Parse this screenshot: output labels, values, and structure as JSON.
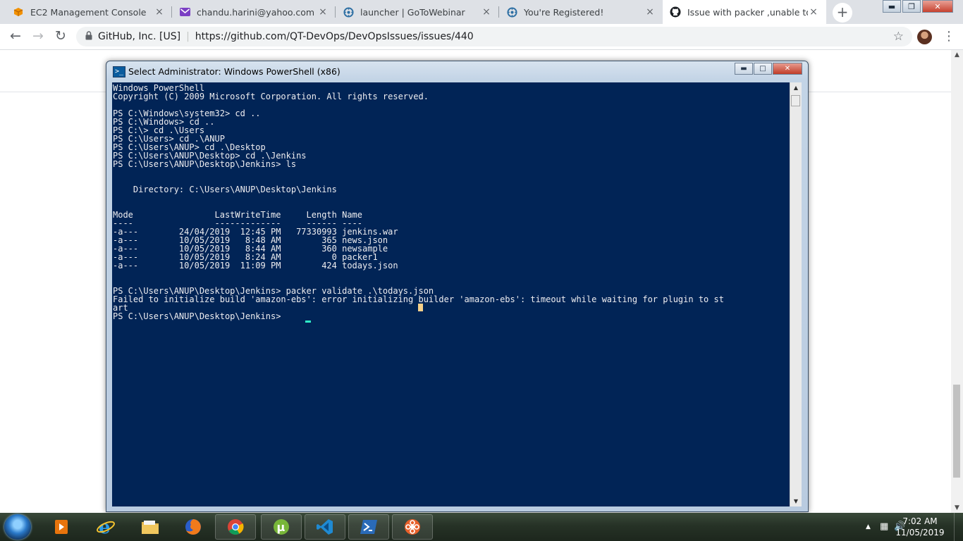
{
  "browser": {
    "tabs": [
      {
        "title": "EC2 Management Console",
        "icon": "aws-cube-icon",
        "active": false
      },
      {
        "title": "chandu.harini@yahoo.com - Ya",
        "icon": "yahoo-mail-icon",
        "active": false
      },
      {
        "title": "launcher | GoToWebinar",
        "icon": "gotowebinar-icon",
        "active": false
      },
      {
        "title": "You're Registered!",
        "icon": "gotowebinar-icon",
        "active": false
      },
      {
        "title": "Issue with packer ,unable to loa",
        "icon": "github-icon",
        "active": true
      }
    ],
    "close_glyph": "×",
    "new_tab_glyph": "+",
    "site_name": "GitHub, Inc. [US]",
    "url": "https://github.com/QT-DevOps/DevOpsIssues/issues/440",
    "accent_color": "#dee1e6"
  },
  "powershell": {
    "title": "Select Administrator: Windows PowerShell (x86)",
    "background_color": "#012456",
    "console_text": "Windows PowerShell\nCopyright (C) 2009 Microsoft Corporation. All rights reserved.\n\nPS C:\\Windows\\system32> cd ..\nPS C:\\Windows> cd ..\nPS C:\\> cd .\\Users\nPS C:\\Users> cd .\\ANUP\nPS C:\\Users\\ANUP> cd .\\Desktop\nPS C:\\Users\\ANUP\\Desktop> cd .\\Jenkins\nPS C:\\Users\\ANUP\\Desktop\\Jenkins> ls\n\n\n    Directory: C:\\Users\\ANUP\\Desktop\\Jenkins\n\n\nMode                LastWriteTime     Length Name\n----                -------------     ------ ----\n-a---        24/04/2019  12:45 PM   77330993 jenkins.war\n-a---        10/05/2019   8:48 AM        365 news.json\n-a---        10/05/2019   8:44 AM        360 newsample\n-a---        10/05/2019   8:24 AM          0 packer1\n-a---        10/05/2019  11:09 PM        424 todays.json\n\n\nPS C:\\Users\\ANUP\\Desktop\\Jenkins> packer validate .\\todays.json\nFailed to initialize build 'amazon-ebs': error initializing builder 'amazon-ebs': timeout while waiting for plugin to st\nart\nPS C:\\Users\\ANUP\\Desktop\\Jenkins> "
  },
  "taskbar": {
    "items": [
      {
        "name": "media-player-icon",
        "open": false
      },
      {
        "name": "internet-explorer-icon",
        "open": false
      },
      {
        "name": "file-explorer-icon",
        "open": false
      },
      {
        "name": "firefox-icon",
        "open": false
      },
      {
        "name": "chrome-icon",
        "open": true
      },
      {
        "name": "utorrent-icon",
        "open": true
      },
      {
        "name": "vscode-icon",
        "open": true
      },
      {
        "name": "powershell-icon",
        "open": true
      },
      {
        "name": "lotus-app-icon",
        "open": true
      }
    ],
    "time": "7:02 AM",
    "date": "11/05/2019"
  }
}
